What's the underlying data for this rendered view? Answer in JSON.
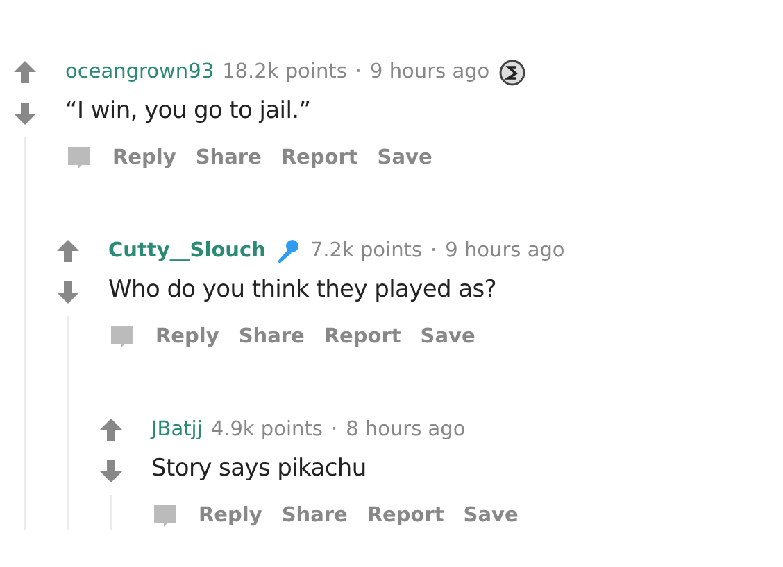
{
  "comments": [
    {
      "author": "oceangrown93",
      "submitter": false,
      "kind": "coin",
      "points": "18.2k points",
      "separator": "·",
      "time": "9 hours ago",
      "body": "“I win, you go to jail.”",
      "actions": [
        "Reply",
        "Share",
        "Report",
        "Save"
      ],
      "children": [
        {
          "author": "Cutty__Slouch",
          "submitter": true,
          "kind": "microphone",
          "points": "7.2k points",
          "separator": "·",
          "time": "9 hours ago",
          "body": "Who do you think they played as?",
          "actions": [
            "Reply",
            "Share",
            "Report",
            "Save"
          ],
          "children": [
            {
              "author": "JBatjj",
              "submitter": false,
              "points": "4.9k points",
              "separator": "·",
              "time": "8 hours ago",
              "body": "Story says pikachu",
              "actions": [
                "Reply",
                "Share",
                "Report",
                "Save"
              ]
            }
          ]
        }
      ]
    }
  ]
}
